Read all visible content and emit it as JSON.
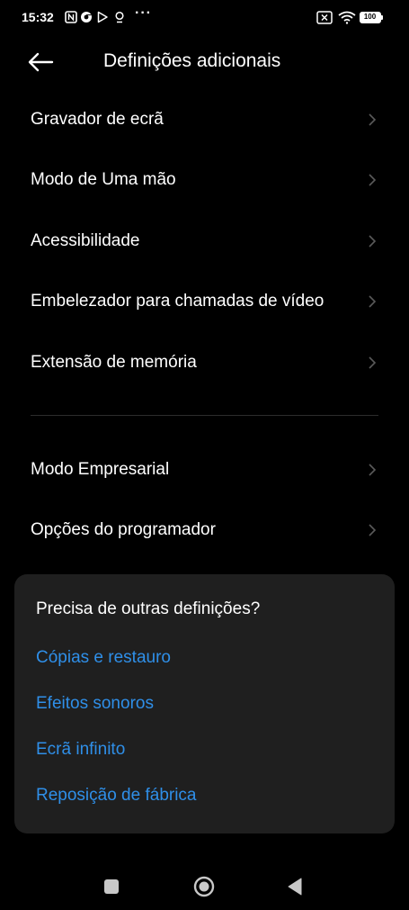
{
  "status_bar": {
    "time": "15:32",
    "more_dots": "···",
    "battery": "100"
  },
  "header": {
    "title": "Definições adicionais"
  },
  "list_group_1": [
    {
      "label": "Gravador de ecrã"
    },
    {
      "label": "Modo de Uma mão"
    },
    {
      "label": "Acessibilidade"
    },
    {
      "label": "Embelezador para chamadas de vídeo"
    },
    {
      "label": "Extensão de memória"
    }
  ],
  "list_group_2": [
    {
      "label": "Modo Empresarial"
    },
    {
      "label": "Opções do programador"
    }
  ],
  "card": {
    "title": "Precisa de outras definições?",
    "links": [
      {
        "label": "Cópias e restauro"
      },
      {
        "label": "Efeitos sonoros"
      },
      {
        "label": "Ecrã infinito"
      },
      {
        "label": "Reposição de fábrica"
      }
    ]
  },
  "colors": {
    "background": "#000000",
    "card_background": "#1f1f1f",
    "link": "#2f8fe8",
    "chevron": "#5a5a5a"
  },
  "icons": {
    "status": [
      "nfc-icon",
      "chrome-icon",
      "play-store-icon",
      "location-icon",
      "no-sim-icon",
      "wifi-icon",
      "battery-icon"
    ],
    "nav": [
      "recents-square-icon",
      "home-circle-icon",
      "back-triangle-icon"
    ]
  }
}
